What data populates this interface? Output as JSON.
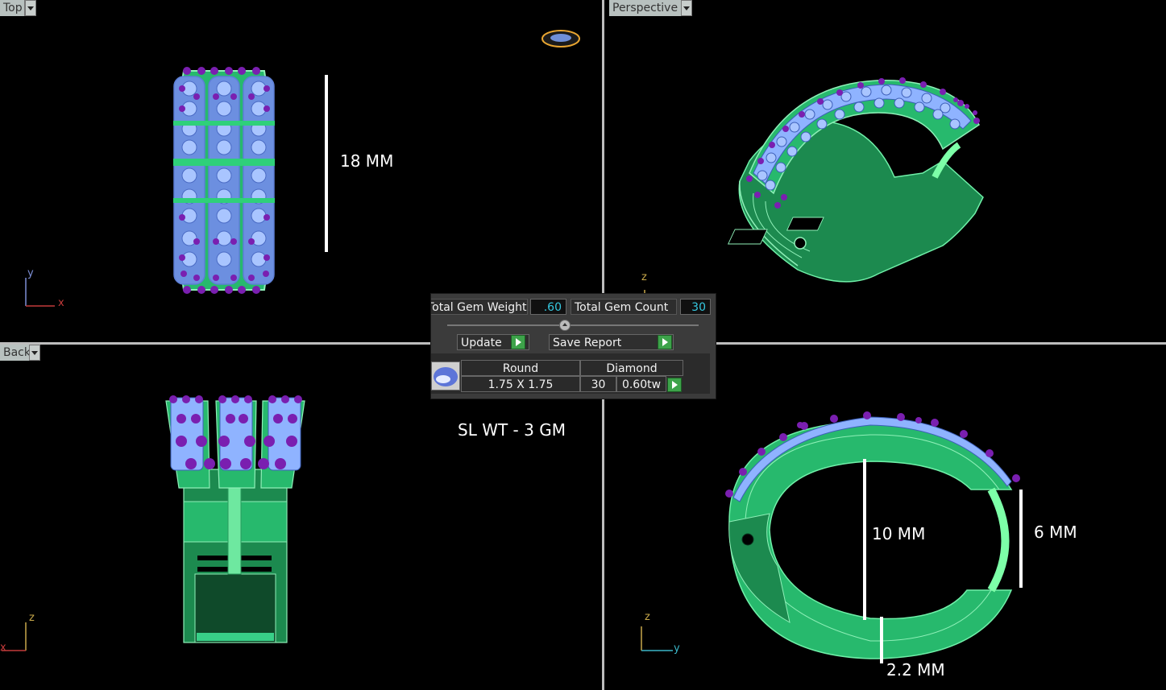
{
  "viewports": {
    "top": {
      "label": "Top"
    },
    "perspective": {
      "label": "Perspective"
    },
    "back": {
      "label": "Back"
    },
    "right": {
      "label": ""
    }
  },
  "axes": {
    "top": {
      "vertical": "y",
      "horizontal": "x"
    },
    "perspective": {
      "vertical": "z",
      "horizontal": "y"
    },
    "back": {
      "vertical": "z",
      "horizontal": "x"
    },
    "right": {
      "vertical": "z",
      "horizontal": "y"
    }
  },
  "annotations": {
    "width": "18 MM",
    "inner_diameter": "10 MM",
    "side_height": "6 MM",
    "thickness": "2.2 MM",
    "weight": "SL WT - 3 GM"
  },
  "gem_report": {
    "total_weight_label": "Total Gem Weight",
    "total_weight_value": ".60",
    "total_count_label": "Total Gem Count",
    "total_count_value": "30",
    "update_label": "Update",
    "save_report_label": "Save Report",
    "rows": [
      {
        "shape": "Round",
        "size": "1.75 X 1.75",
        "material": "Diamond",
        "count": "30",
        "weight": "0.60tw"
      }
    ]
  },
  "colors": {
    "metal": "#2fbf72",
    "metal_dark": "#1c8a4f",
    "gem": "#8fb3ff",
    "prong": "#6a1a9a",
    "annotation": "#ffffff",
    "value_text": "#35c8e0"
  }
}
